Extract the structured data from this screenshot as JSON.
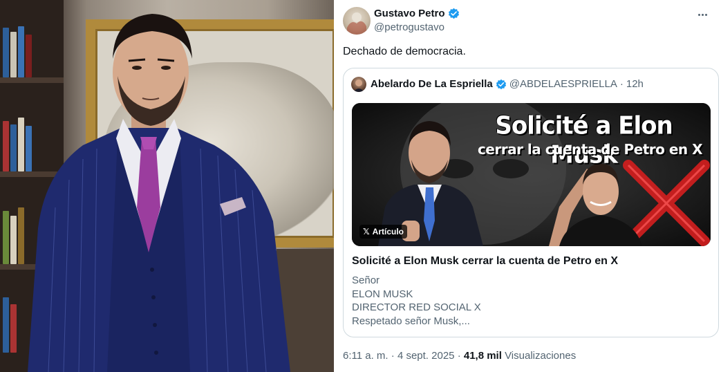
{
  "tweet": {
    "author": {
      "name": "Gustavo Petro",
      "handle": "@petrogustavo",
      "verified_color": "#1d9bf0"
    },
    "text": "Dechado de democracia.",
    "quote": {
      "author_name": "Abelardo De La Espriella",
      "author_handle": "@ABDELAESPRIELLA",
      "separator": "·",
      "time": "12h",
      "media": {
        "headline": "Solicité a Elon Musk",
        "subheadline": "cerrar la cuenta de Petro en X",
        "badge": "Artículo",
        "accent_color": "#d61f1f"
      },
      "article_title": "Solicité a Elon Musk cerrar la cuenta de Petro en X",
      "body_lines": [
        "Señor",
        "ELON MUSK",
        "DIRECTOR RED SOCIAL X",
        "Respetado señor Musk,..."
      ]
    },
    "meta": {
      "time": "6:11 a. m.",
      "separator": "·",
      "date": "4 sept. 2025",
      "separator2": "·",
      "views_count": "41,8 mil",
      "views_label": "Visualizaciones"
    }
  }
}
